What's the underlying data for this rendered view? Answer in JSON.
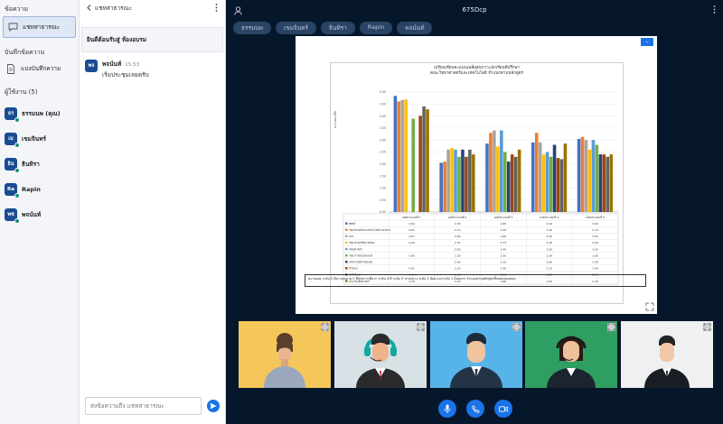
{
  "sidebar": {
    "messages_heading": "ข้อความ",
    "public_chat_label": "แชทสาธารณะ",
    "notes_heading": "บันทึกข้อความ",
    "shared_notes_label": "แบ่งบันทึกความ",
    "users_heading": "ผู้ใช้งาน (5)",
    "users": [
      {
        "initials": "ธร",
        "name": "ธรรมนพ (คุณ)"
      },
      {
        "initials": "เม",
        "name": "เขมจินทร์"
      },
      {
        "initials": "ธิน",
        "name": "ธินทิรา"
      },
      {
        "initials": "Ra",
        "name": "Rapin"
      },
      {
        "initials": "พช",
        "name": "พจน์นท์"
      }
    ]
  },
  "chat": {
    "title": "แชทสาธารณะ",
    "welcome": "ยินดีต้อนรับสู่ ห้องอบรม",
    "message": {
      "initials": "พจ",
      "sender": "พจน์นท์",
      "time": "15:53",
      "text": "เริ่มประชุมเลยครับ"
    },
    "input_placeholder": "ส่งข้อความถึง แชทสาธารณะ"
  },
  "main": {
    "meeting_title": "675Dcp",
    "tabs": [
      "ธรรมนพ",
      "เขมจินทร์",
      "ธินทิรา",
      "Rapin",
      "พจน์นท์"
    ]
  },
  "slide": {
    "title_line1": "เปรียบเทียบคะแนนเฉลี่ยสุขภาวะนักเรียนที่ปรึกษา",
    "title_line2": "คณะวิทยาศาสตร์และเทคโนโลยี จำแนกตามหลักสูตร",
    "ylabel": "คะแนนเฉลี่ย",
    "footnote": "หมายเหตุ  ระดับ 5 มีความหมายว่า มีสุขภาวะดีมาก ระดับ 4 ดี ระดับ 3 ปานกลาง ระดับ 2 น้อย และระดับ 1 น้อยมาก จำแนกตามหลักสูตรทั้งหมดของคณะ"
  },
  "colors": {
    "accent": "#1a73e8",
    "main_bg": "#06172b",
    "tab_bg": "#2a4466",
    "status_green": "#1b8f7a"
  },
  "chart_data": {
    "type": "bar",
    "categories": [
      "องค์ประกอบที่ 1",
      "องค์ประกอบที่ 2",
      "องค์ประกอบที่ 3",
      "องค์ประกอบที่ 4",
      "องค์ประกอบที่ 5"
    ],
    "ylim": [
      0,
      5
    ],
    "yticks": [
      0,
      0.5,
      1,
      1.5,
      2,
      2.5,
      3,
      3.5,
      4,
      4.5,
      5
    ],
    "series": [
      {
        "name": "ฟิสิกส์",
        "color": "#4472c4",
        "values": [
          4.84,
          2.05,
          2.85,
          2.9,
          3.05
        ]
      },
      {
        "name": "วิทยาศาสตร์และเทคโนโลยีการอาหาร",
        "color": "#ed7d31",
        "values": [
          4.61,
          2.1,
          3.3,
          3.3,
          3.13
        ]
      },
      {
        "name": "เคมี",
        "color": "#a5a5a5",
        "values": [
          4.67,
          2.6,
          3.4,
          2.9,
          3.0
        ]
      },
      {
        "name": "วิทยาศาสตร์สิ่งแวดล้อม",
        "color": "#ffc000",
        "values": [
          4.69,
          2.67,
          2.73,
          2.4,
          2.6
        ]
      },
      {
        "name": "คณิตศาสตร์",
        "color": "#5b9bd5",
        "values": [
          0,
          2.6,
          3.4,
          2.5,
          3.0
        ]
      },
      {
        "name": "วิทยาการคอมพิวเตอร์",
        "color": "#70ad47",
        "values": [
          3.89,
          2.3,
          2.5,
          2.3,
          2.8
        ]
      },
      {
        "name": "เทคโนโลยีสารสนเทศ",
        "color": "#264478",
        "values": [
          0,
          2.6,
          2.1,
          2.8,
          2.4
        ]
      },
      {
        "name": "ชีววิทยา",
        "color": "#9e480e",
        "values": [
          4.01,
          2.3,
          2.4,
          2.25,
          2.4
        ]
      },
      {
        "name": "จุลชีววิทยา",
        "color": "#636363",
        "values": [
          4.4,
          2.6,
          2.3,
          2.2,
          2.3
        ]
      },
      {
        "name": "สาธารณสุขศาสตร์",
        "color": "#997300",
        "values": [
          4.28,
          2.4,
          2.6,
          2.85,
          2.4
        ]
      }
    ]
  }
}
